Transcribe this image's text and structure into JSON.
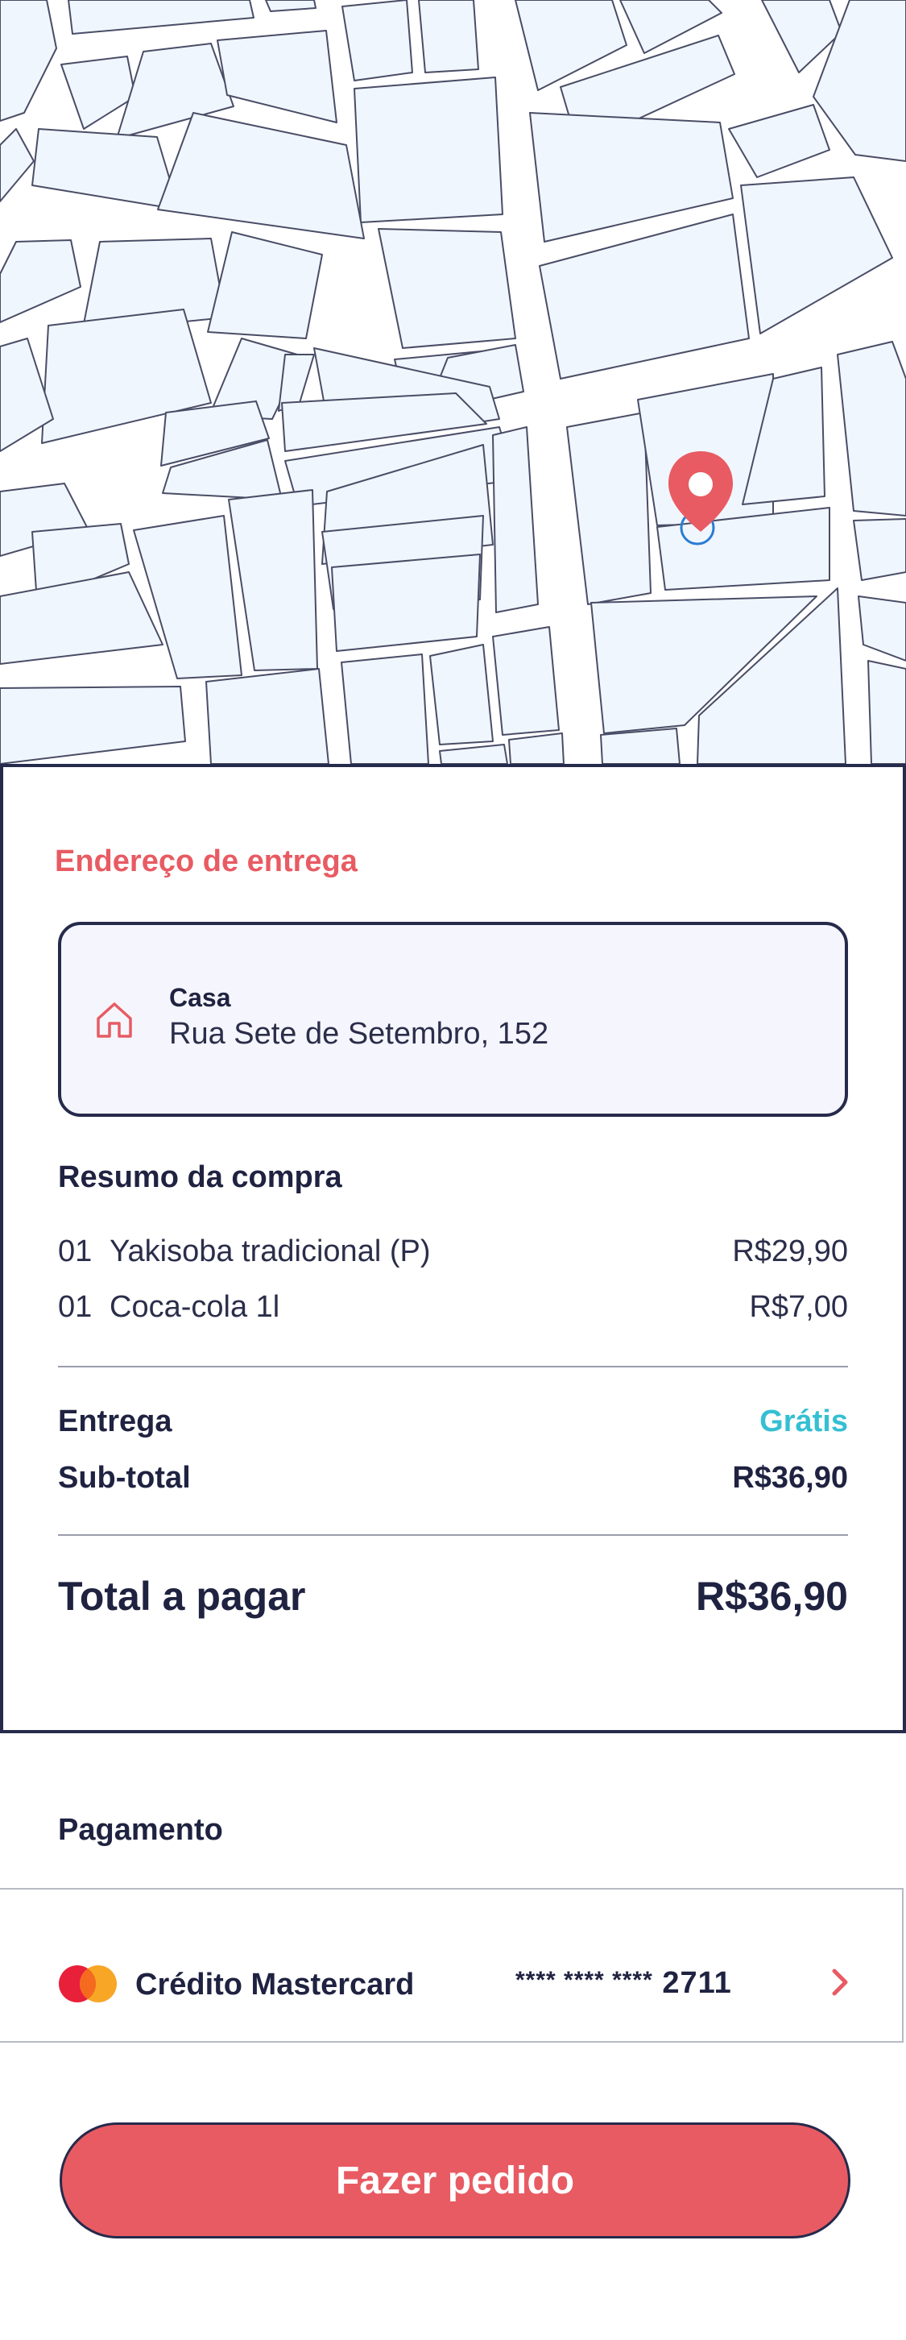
{
  "map": {
    "pin_icon": "location-pin-icon",
    "marker_icon": "current-location-icon",
    "colors": {
      "block": "#f0f6fd",
      "road": "#ffffff",
      "outline": "#4a4d66",
      "pin": "#e85b63",
      "marker": "#2a7dd4"
    }
  },
  "delivery": {
    "section_title": "Endereço de entrega",
    "icon": "home-icon",
    "name": "Casa",
    "street": "Rua Sete de Setembro, 152"
  },
  "summary": {
    "title": "Resumo da compra",
    "items": [
      {
        "qty": "01",
        "name": "Yakisoba tradicional (P)",
        "price": "R$29,90"
      },
      {
        "qty": "01",
        "name": "Coca-cola 1l",
        "price": "R$7,00"
      }
    ],
    "delivery_label": "Entrega",
    "delivery_value": "Grátis",
    "subtotal_label": "Sub-total",
    "subtotal_value": "R$36,90",
    "total_label": "Total a pagar",
    "total_value": "R$36,90"
  },
  "payment": {
    "title": "Pagamento",
    "icon": "mastercard-icon",
    "method": "Crédito Mastercard",
    "card_mask": "**** **** ****",
    "card_last4": "2711",
    "chevron_icon": "chevron-right-icon"
  },
  "action": {
    "button_label": "Fazer pedido"
  },
  "colors": {
    "accent": "#e85b63",
    "free": "#35bfd3",
    "text": "#1f2240",
    "border": "#262a4b"
  }
}
